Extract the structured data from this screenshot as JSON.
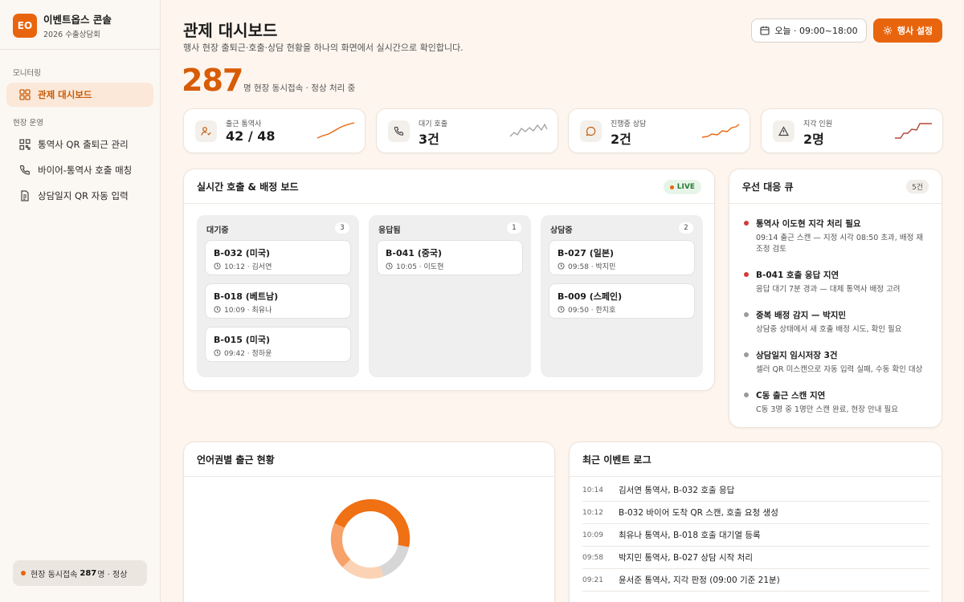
{
  "brand": {
    "logo": "EO",
    "name": "이벤트옵스 콘솔",
    "sub": "2026 수출상담회"
  },
  "sidebar": {
    "section_monitoring": "모니터링",
    "section_ops": "현장 운영",
    "items": [
      {
        "label": "관제 대시보드",
        "icon": "grid-icon",
        "active": true
      },
      {
        "label": "통역사 QR 출퇴근 관리",
        "icon": "qr-icon"
      },
      {
        "label": "바이어-통역사 호출 매칭",
        "icon": "phone-icon"
      },
      {
        "label": "상담일지 QR 자동 입력",
        "icon": "document-icon"
      }
    ],
    "footer": {
      "prefix": "현장 동시접속",
      "count": "287",
      "suffix": "명 · 정상"
    }
  },
  "header": {
    "title": "관제 대시보드",
    "subtitle": "행사 현장 출퇴근·호출·상담 현황을 하나의 화면에서 실시간으로 확인합니다.",
    "time_button": "오늘 · 09:00~18:00",
    "event_button": "행사 설정"
  },
  "hero": {
    "value": "287",
    "caption": "명 현장 동시접속 · 정상 처리 중"
  },
  "kpis": [
    {
      "label": "출근 통역사",
      "value": "42 / 48",
      "icon": "person-check-icon",
      "spark_color": "#e8650e"
    },
    {
      "label": "대기 호출",
      "value": "3건",
      "icon": "phone-icon",
      "spark_color": "#999999"
    },
    {
      "label": "진행중 상담",
      "value": "2건",
      "icon": "chat-icon",
      "spark_color": "#e8650e"
    },
    {
      "label": "지각 인원",
      "value": "2명",
      "icon": "warning-icon",
      "spark_color": "#b5473a"
    }
  ],
  "board": {
    "title": "실시간 호출 & 배정 보드",
    "live": "LIVE",
    "columns": [
      {
        "name": "대기중",
        "count": "3",
        "cards": [
          {
            "id": "B-032 (미국)",
            "meta": "10:12 · 김서연"
          },
          {
            "id": "B-018 (베트남)",
            "meta": "10:09 · 최유나"
          },
          {
            "id": "B-015 (미국)",
            "meta": "09:42 · 정하윤"
          }
        ]
      },
      {
        "name": "응답됨",
        "count": "1",
        "cards": [
          {
            "id": "B-041 (중국)",
            "meta": "10:05 · 이도현"
          }
        ]
      },
      {
        "name": "상담중",
        "count": "2",
        "cards": [
          {
            "id": "B-027 (일본)",
            "meta": "09:58 · 박지민"
          },
          {
            "id": "B-009 (스페인)",
            "meta": "09:50 · 한지호"
          }
        ]
      }
    ]
  },
  "queue": {
    "title": "우선 대응 큐",
    "count": "5건",
    "items": [
      {
        "title": "통역사 이도현 지각 처리 필요",
        "desc": "09:14 출근 스캔 — 지정 시각 08:50 초과, 배정 재조정 검토",
        "severity": "#d23b3b"
      },
      {
        "title": "B-041 호출 응답 지연",
        "desc": "응답 대기 7분 경과 — 대체 통역사 배정 고려",
        "severity": "#d23b3b"
      },
      {
        "title": "중복 배정 감지 — 박지민",
        "desc": "상담중 상태에서 새 호출 배정 시도, 확인 필요",
        "severity": "#9a9a9a"
      },
      {
        "title": "상담일지 임시저장 3건",
        "desc": "셀러 QR 미스캔으로 자동 입력 실패, 수동 확인 대상",
        "severity": "#9a9a9a"
      },
      {
        "title": "C동 출근 스캔 지연",
        "desc": "C동 3명 중 1명만 스캔 완료, 현장 안내 필요",
        "severity": "#9a9a9a"
      }
    ]
  },
  "language": {
    "title": "언어권별 출근 현황",
    "segment_colors": [
      "#f07014",
      "#f6a26a",
      "#fbd3b4",
      "#d6d6d6"
    ]
  },
  "log": {
    "title": "최근 이벤트 로그",
    "rows": [
      {
        "time": "10:14",
        "msg": "김서연 통역사, B-032 호출 응답"
      },
      {
        "time": "10:12",
        "msg": "B-032 바이어 도착 QR 스캔, 호출 요청 생성"
      },
      {
        "time": "10:09",
        "msg": "최유나 통역사, B-018 호출 대기열 등록"
      },
      {
        "time": "09:58",
        "msg": "박지민 통역사, B-027 상담 시작 처리"
      },
      {
        "time": "09:21",
        "msg": "윤서준 통역사, 지각 판정 (09:00 기준 21분)"
      }
    ]
  }
}
